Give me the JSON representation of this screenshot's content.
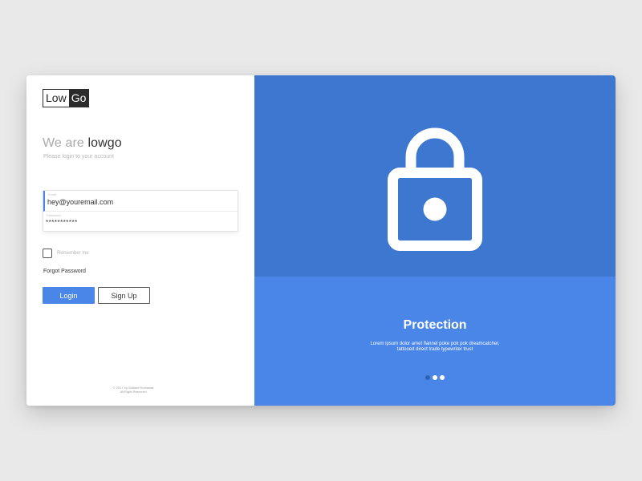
{
  "logo": {
    "part1": "Low",
    "part2": "Go"
  },
  "heading": {
    "prefix": "We are ",
    "brand": "lowgo"
  },
  "subheading": "Please login to your account",
  "form": {
    "email_label": "Email",
    "email_value": "hey@youremail.com",
    "password_label": "Password",
    "password_value": "***********"
  },
  "remember_label": "Remember me",
  "forgot_label": "Forgot Password",
  "buttons": {
    "login": "Login",
    "signup": "Sign Up"
  },
  "footer": {
    "line1": "© 2017 by Sidhant Kumawat",
    "line2": "All Right Reserved"
  },
  "hero": {
    "icon": "lock-icon",
    "title": "Protection",
    "text_line1": "Lorem ipsum dolor amet flannel poke pok pok dreamcatcher,",
    "text_line2": "tattooed direct trade typewriter trust"
  },
  "carousel": {
    "count": 3,
    "active_index": 1
  },
  "colors": {
    "accent": "#4a86e8",
    "hero_top": "#3e77cf",
    "hero_bottom": "#4a86e8",
    "background": "#e9e9e9"
  }
}
